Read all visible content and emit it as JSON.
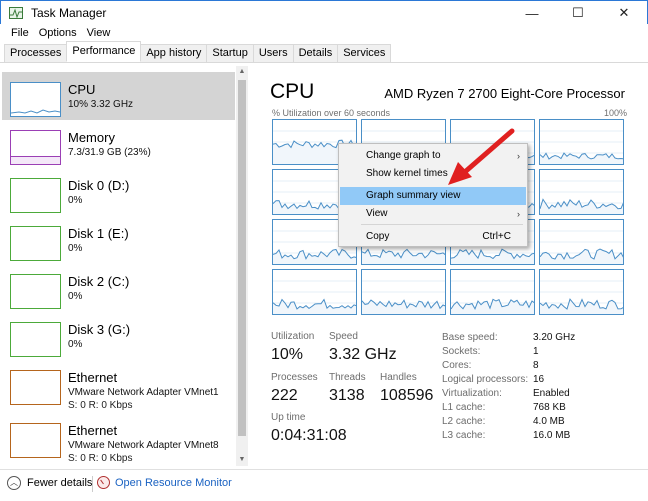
{
  "window": {
    "title": "Task Manager",
    "minimize": "—",
    "maximize": "☐",
    "close": "✕"
  },
  "menu": [
    "File",
    "Options",
    "View"
  ],
  "tabs": [
    "Processes",
    "Performance",
    "App history",
    "Startup",
    "Users",
    "Details",
    "Services"
  ],
  "sidebar": [
    {
      "name": "CPU",
      "line1": "10% 3.32 GHz",
      "line2": "",
      "color": "#4a8fc7"
    },
    {
      "name": "Memory",
      "line1": "7.3/31.9 GB (23%)",
      "line2": "",
      "color": "#9b3fb5"
    },
    {
      "name": "Disk 0 (D:)",
      "line1": "0%",
      "line2": "",
      "color": "#4caa3a"
    },
    {
      "name": "Disk 1 (E:)",
      "line1": "0%",
      "line2": "",
      "color": "#4caa3a"
    },
    {
      "name": "Disk 2 (C:)",
      "line1": "0%",
      "line2": "",
      "color": "#4caa3a"
    },
    {
      "name": "Disk 3 (G:)",
      "line1": "0%",
      "line2": "",
      "color": "#4caa3a"
    },
    {
      "name": "Ethernet",
      "line1": "VMware Network Adapter VMnet1",
      "line2": "S: 0 R: 0 Kbps",
      "color": "#b5651d"
    },
    {
      "name": "Ethernet",
      "line1": "VMware Network Adapter VMnet8",
      "line2": "S: 0 R: 0 Kbps",
      "color": "#b5651d"
    }
  ],
  "cpu": {
    "title": "CPU",
    "model": "AMD Ryzen 7 2700 Eight-Core Processor",
    "util_label": "% Utilization over 60 seconds",
    "util_max": "100%"
  },
  "stats": {
    "utilization_label": "Utilization",
    "utilization": "10%",
    "speed_label": "Speed",
    "speed": "3.32 GHz",
    "processes_label": "Processes",
    "processes": "222",
    "threads_label": "Threads",
    "threads": "3138",
    "handles_label": "Handles",
    "handles": "108596",
    "uptime_label": "Up time",
    "uptime": "0:04:31:08"
  },
  "info": [
    {
      "label": "Base speed:",
      "value": "3.20 GHz"
    },
    {
      "label": "Sockets:",
      "value": "1"
    },
    {
      "label": "Cores:",
      "value": "8"
    },
    {
      "label": "Logical processors:",
      "value": "16"
    },
    {
      "label": "Virtualization:",
      "value": "Enabled"
    },
    {
      "label": "L1 cache:",
      "value": "768 KB"
    },
    {
      "label": "L2 cache:",
      "value": "4.0 MB"
    },
    {
      "label": "L3 cache:",
      "value": "16.0 MB"
    }
  ],
  "context_menu": [
    {
      "label": "Change graph to",
      "submenu": true,
      "shortcut": ""
    },
    {
      "label": "Show kernel times",
      "submenu": false,
      "shortcut": ""
    },
    {
      "label": "Graph summary view",
      "submenu": false,
      "shortcut": "",
      "highlighted": true
    },
    {
      "label": "View",
      "submenu": true,
      "shortcut": ""
    },
    {
      "label": "Copy",
      "submenu": false,
      "shortcut": "Ctrl+C"
    }
  ],
  "footer": {
    "fewer_details": "Fewer details",
    "resource_monitor": "Open Resource Monitor"
  },
  "colors": {
    "cpu": "#4a8fc7",
    "memory": "#9b3fb5",
    "disk": "#4caa3a",
    "ethernet": "#b5651d",
    "highlight": "#91c9f7",
    "link": "#1a62c2",
    "annotation": "#e02020"
  }
}
